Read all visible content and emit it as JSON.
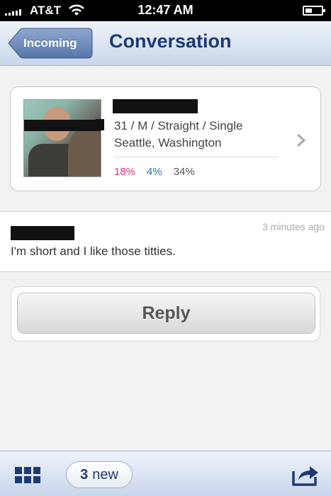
{
  "status_bar": {
    "carrier": "AT&T",
    "time": "12:47 AM"
  },
  "nav": {
    "back_label": "Incoming",
    "title": "Conversation"
  },
  "profile": {
    "details_line1": "31 / M / Straight / Single",
    "details_line2": "Seattle, Washington",
    "match_percent": "18%",
    "friend_percent": "4%",
    "enemy_percent": "34%"
  },
  "message": {
    "timestamp": "3 minutes ago",
    "text": "I'm short and I like those titties."
  },
  "reply": {
    "label": "Reply"
  },
  "toolbar": {
    "new_count": "3",
    "new_label": "new"
  },
  "colors": {
    "nav_title": "#1c3b73",
    "match": "#e0327a",
    "friend": "#3a6bb0"
  }
}
